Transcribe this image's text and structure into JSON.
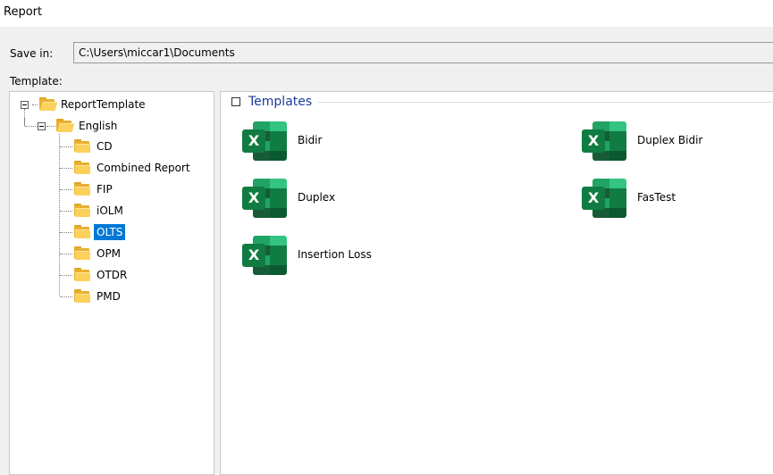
{
  "window": {
    "title": "Report"
  },
  "save_in": {
    "label": "Save in:",
    "path": "C:\\Users\\miccar1\\Documents"
  },
  "template": {
    "label": "Template:"
  },
  "tree": {
    "root": "ReportTemplate",
    "language": "English",
    "folders": [
      "CD",
      "Combined Report",
      "FIP",
      "iOLM",
      "OLTS",
      "OPM",
      "OTDR",
      "PMD"
    ],
    "selected": "OLTS"
  },
  "templates_group": {
    "title": "Templates",
    "items": [
      "Bidir",
      "Duplex Bidir",
      "Duplex",
      "FasTest",
      "Insertion Loss"
    ],
    "icon": "excel-icon",
    "icon_letter": "X"
  },
  "colors": {
    "selection": "#0078d7",
    "group_title": "#1a3c9a",
    "excel_green": "#107c41",
    "folder": "#fcd15b"
  }
}
